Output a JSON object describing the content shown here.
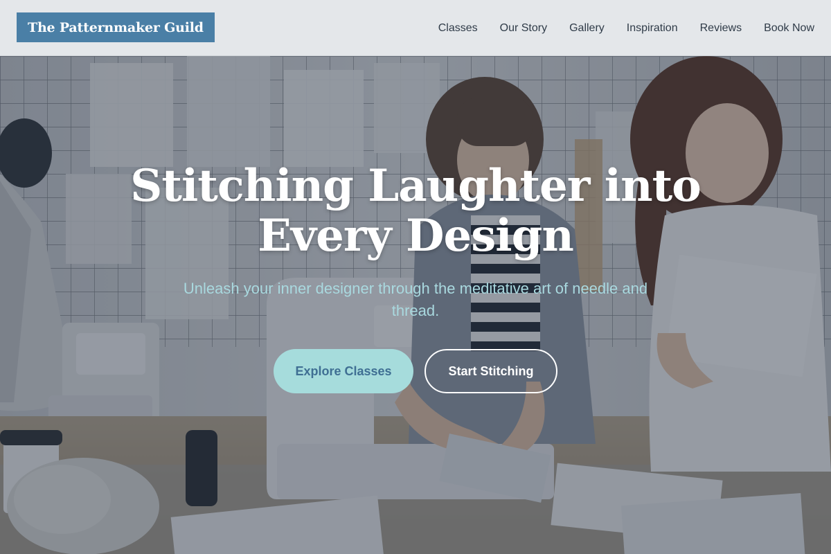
{
  "site": {
    "logo_text": "The Patternmaker Guild"
  },
  "nav": {
    "items": [
      {
        "label": "Classes"
      },
      {
        "label": "Our Story"
      },
      {
        "label": "Gallery"
      },
      {
        "label": "Inspiration"
      },
      {
        "label": "Reviews"
      },
      {
        "label": "Book Now"
      }
    ]
  },
  "hero": {
    "title_line1": "Stitching Laughter into",
    "title_line2": "Every Design",
    "subtitle_line1": "Unleash your inner designer through the meditative art of needle and",
    "subtitle_line2": "thread.",
    "primary_button": "Explore Classes",
    "secondary_button": "Start Stitching"
  },
  "colors": {
    "logo_bg": "#4a7fa6",
    "header_bg": "#eceef0",
    "nav_text": "#2f3b48",
    "subtitle": "#a9d9df",
    "primary_button_bg": "#a6dcdc",
    "primary_button_text": "#3f6f93",
    "overlay": "#243042"
  },
  "icons": {
    "hero_background": "sewing-workshop-photo"
  }
}
